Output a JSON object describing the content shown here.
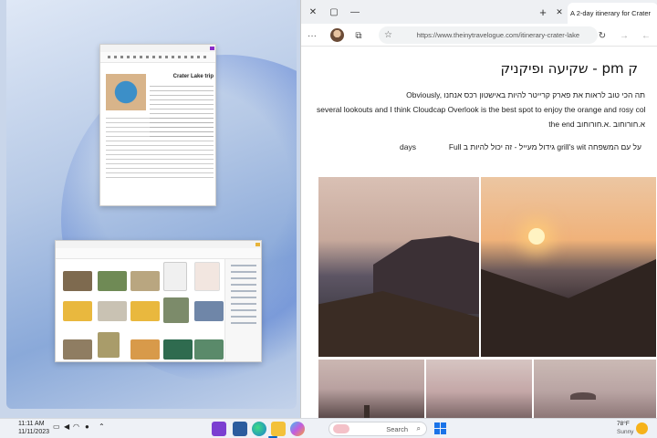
{
  "browser": {
    "tab_title": "A 2-day itinerary for Crater",
    "url": "https://www.theinytravelogue.com/itinerary-crater-lake",
    "heading": "ק pm - שקיעה ופיקניק",
    "para1_line1": "Obviously, תה הכי טוב לראות את פארק קרייטר להיות באישטון רכס אנחנו",
    "para1_line2": "several lookouts and I think Cloudcap Overlook is the best spot to enjoy the orange and rosy colours at",
    "para1_line3": "the end א.חורוחוב .א.חורוחוב",
    "para2_left": "days",
    "para2_right": "Full גידול מעייל - זה יכול להיות ב grill's wit על עם המשפחה"
  },
  "word_doc": {
    "title": "Crater Lake trip"
  },
  "taskbar": {
    "search_placeholder": "Search",
    "time": "11:11 AM",
    "date": "11/11/2023",
    "weather_temp": "78°F",
    "weather_desc": "Sunny"
  },
  "colors": {
    "accent": "#0a64c8",
    "browser_bg": "#ffffff",
    "taskbar_bg": "#eef1f6"
  }
}
